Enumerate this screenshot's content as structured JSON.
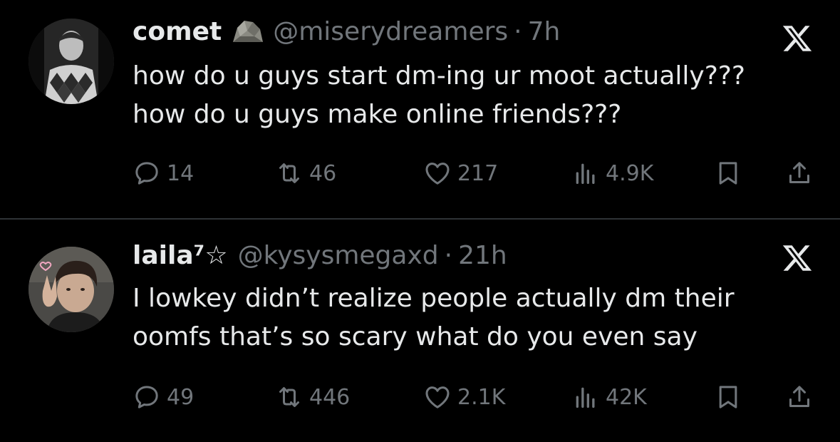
{
  "tweets": [
    {
      "display_name": "comet",
      "handle": "@miserydreamers",
      "separator": "·",
      "time": "7h",
      "lines": [
        "how do u guys start dm-ing ur moot actually???",
        "how do u guys make online friends???"
      ],
      "replies": "14",
      "retweets": "46",
      "likes": "217",
      "views": "4.9K"
    },
    {
      "display_name": "laila⁷☆",
      "handle": "@kysysmegaxd",
      "separator": "·",
      "time": "21h",
      "lines": [
        "I lowkey didn’t realize people actually dm their",
        "oomfs that’s so scary what do you even say"
      ],
      "replies": "49",
      "retweets": "446",
      "likes": "2.1K",
      "views": "42K"
    }
  ],
  "icons": {
    "reply": "reply-icon",
    "retweet": "retweet-icon",
    "like": "heart-icon",
    "views": "views-icon",
    "bookmark": "bookmark-icon",
    "share": "share-icon",
    "brand": "x-logo-icon"
  },
  "colors": {
    "background": "#000000",
    "text": "#e7e9ea",
    "muted": "#71767b",
    "divider": "#2f3336"
  }
}
